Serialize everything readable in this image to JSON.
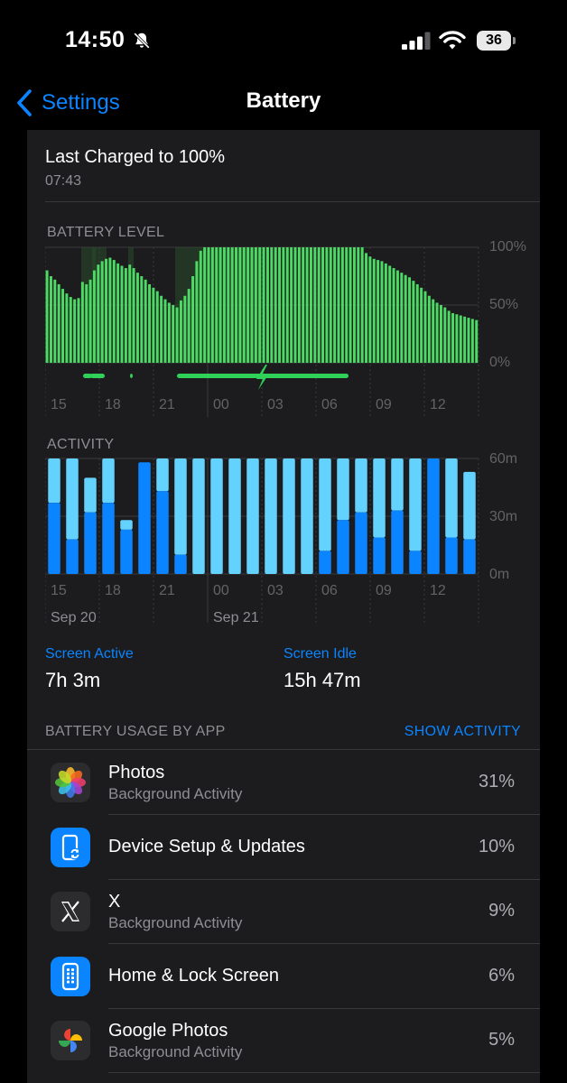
{
  "status_bar": {
    "time": "14:50",
    "battery_level": "36"
  },
  "nav": {
    "back_label": "Settings",
    "title": "Battery"
  },
  "last_charged": {
    "title": "Last Charged to 100%",
    "time": "07:43"
  },
  "battery_level_chart": {
    "heading": "BATTERY LEVEL",
    "y_ticks": [
      "100%",
      "50%",
      "0%"
    ],
    "x_ticks": [
      "15",
      "18",
      "21",
      "00",
      "03",
      "06",
      "09",
      "12"
    ],
    "bar_color": "#4cd964",
    "charge_color": "#30d158",
    "charging_segments": [
      [
        2,
        3
      ],
      [
        2.5,
        3.5
      ],
      [
        6,
        16
      ]
    ],
    "charging_icon": "bolt-icon",
    "chart_data": {
      "type": "bar",
      "ylabel": "",
      "ylim": [
        0,
        100
      ],
      "values": [
        80,
        75,
        72,
        68,
        64,
        60,
        57,
        55,
        56,
        70,
        68,
        72,
        80,
        85,
        88,
        90,
        91,
        89,
        86,
        84,
        82,
        85,
        82,
        78,
        75,
        72,
        68,
        65,
        62,
        58,
        55,
        52,
        50,
        48,
        54,
        58,
        64,
        75,
        88,
        97,
        100,
        100,
        100,
        100,
        100,
        100,
        100,
        100,
        100,
        100,
        100,
        100,
        100,
        100,
        100,
        100,
        100,
        100,
        100,
        100,
        100,
        100,
        100,
        100,
        100,
        100,
        100,
        100,
        100,
        100,
        100,
        100,
        100,
        100,
        100,
        100,
        100,
        100,
        100,
        100,
        100,
        95,
        92,
        90,
        89,
        88,
        86,
        84,
        82,
        80,
        78,
        76,
        74,
        71,
        68,
        65,
        62,
        58,
        55,
        52,
        50,
        48,
        45,
        43,
        42,
        41,
        40,
        39,
        38,
        37
      ]
    }
  },
  "activity_chart": {
    "heading": "ACTIVITY",
    "y_ticks": [
      "60m",
      "30m",
      "0m"
    ],
    "x_ticks": [
      "15",
      "18",
      "21",
      "00",
      "03",
      "06",
      "09",
      "12"
    ],
    "date_labels": [
      "Sep 20",
      "Sep 21"
    ],
    "active_color": "#0a84ff",
    "idle_color": "#64d2ff",
    "chart_data": {
      "type": "bar",
      "categories": [
        "15",
        "16",
        "17",
        "18",
        "19",
        "20",
        "21",
        "22",
        "23",
        "00",
        "01",
        "02",
        "03",
        "04",
        "05",
        "06",
        "07",
        "08",
        "09",
        "10",
        "11",
        "12",
        "13",
        "14"
      ],
      "series": [
        {
          "name": "Screen Active",
          "values": [
            37,
            18,
            32,
            37,
            23,
            58,
            43,
            10,
            0,
            0,
            0,
            0,
            0,
            0,
            0,
            12,
            28,
            32,
            19,
            33,
            12,
            60,
            19,
            18
          ]
        },
        {
          "name": "Screen Idle",
          "values": [
            23,
            42,
            18,
            23,
            5,
            0,
            17,
            50,
            60,
            60,
            60,
            60,
            60,
            60,
            60,
            48,
            32,
            28,
            41,
            27,
            48,
            0,
            41,
            35
          ]
        }
      ],
      "ylim": [
        0,
        60
      ]
    }
  },
  "screen_stats": {
    "active_label": "Screen Active",
    "active_value": "7h 3m",
    "idle_label": "Screen Idle",
    "idle_value": "15h 47m"
  },
  "usage": {
    "heading": "BATTERY USAGE BY APP",
    "show_activity": "SHOW ACTIVITY",
    "apps": [
      {
        "name": "Photos",
        "subtitle": "Background Activity",
        "percent": "31%",
        "icon": "photos-icon"
      },
      {
        "name": "Device Setup & Updates",
        "subtitle": "",
        "percent": "10%",
        "icon": "device-setup-icon"
      },
      {
        "name": "X",
        "subtitle": "Background Activity",
        "percent": "9%",
        "icon": "x-app-icon"
      },
      {
        "name": "Home & Lock Screen",
        "subtitle": "",
        "percent": "6%",
        "icon": "home-lock-icon"
      },
      {
        "name": "Google Photos",
        "subtitle": "Background Activity",
        "percent": "5%",
        "icon": "google-photos-icon"
      }
    ]
  }
}
